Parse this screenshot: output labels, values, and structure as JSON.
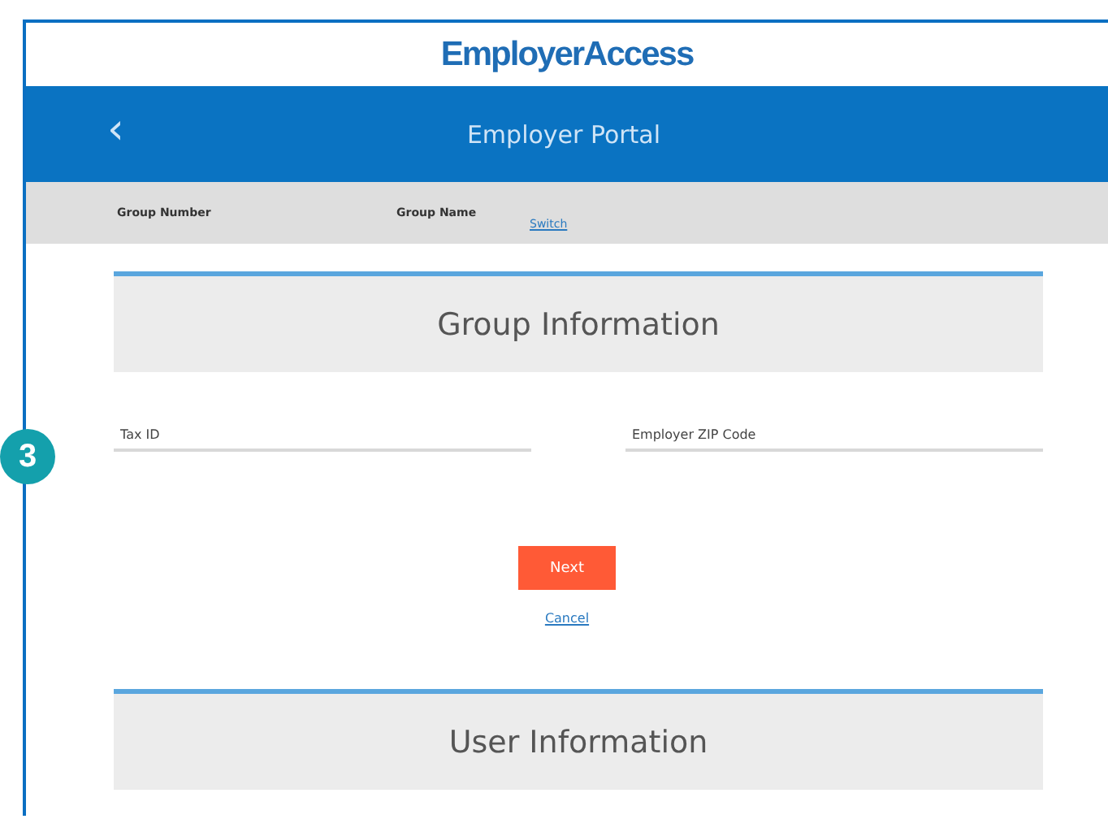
{
  "brand": {
    "title": "EmployerAccess"
  },
  "header": {
    "back_icon": "‹",
    "title": "Employer Portal"
  },
  "group_bar": {
    "fields": [
      {
        "label": "Group Number"
      },
      {
        "label": "Group Name"
      }
    ],
    "switch_link": "Switch"
  },
  "step_badge": "3",
  "sections": [
    {
      "title": "Group Information"
    },
    {
      "title": "User Information"
    }
  ],
  "form": {
    "fields": [
      {
        "placeholder": "Tax ID"
      },
      {
        "placeholder": "Employer ZIP Code"
      }
    ],
    "next_button": "Next",
    "cancel_link": "Cancel"
  }
}
